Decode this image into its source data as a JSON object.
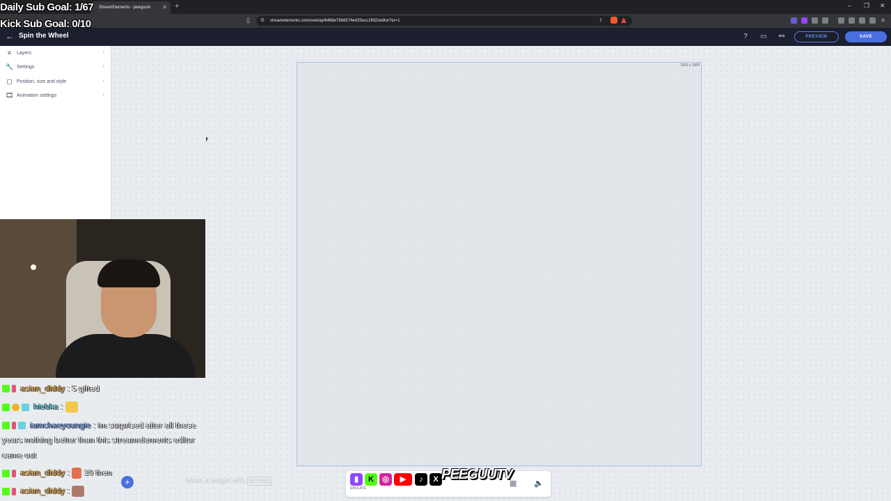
{
  "browser": {
    "tab_title": "StreamElements - peeguutv",
    "url": "streamelements.com/overlay/6468e789d574e425ecc1ffd2/editor?er=1"
  },
  "app": {
    "title": "Spin the Wheel",
    "preview_label": "PREVIEW",
    "save_label": "SAVE"
  },
  "sidebar": {
    "items": [
      {
        "label": "Layers",
        "icon": "menu-icon"
      },
      {
        "label": "Settings",
        "icon": "wrench-icon"
      },
      {
        "label": "Position, size and style",
        "icon": "square-icon"
      },
      {
        "label": "Animation settings",
        "icon": "film-icon"
      }
    ]
  },
  "canvas": {
    "dimensions": "1001 x 1000"
  },
  "overlay": {
    "daily_goal": "Daily Sub Goal: 1/67",
    "kick_goal": "Kick Sub Goal: 0/10"
  },
  "chat": [
    {
      "user": "asian_diddy",
      "separator": ":",
      "message": "5 gifted"
    },
    {
      "user": "hiebka",
      "separator": ":",
      "message": ""
    },
    {
      "user": "iamchaeyoungie",
      "separator": ":",
      "message": "im surprised after all these"
    },
    {
      "continuation": "years nothing better than this streamelements editor"
    },
    {
      "continuation": "came out"
    },
    {
      "user": "asian_diddy",
      "separator": ":",
      "message": "10 then"
    },
    {
      "user": "asian_diddy",
      "separator": ":",
      "message": ""
    }
  ],
  "hint": {
    "text": "Move a widget with",
    "key": "arrows"
  },
  "bottom_bar": {
    "emulate_label": "EMULATE",
    "brand_text": "PEEGUUTV"
  },
  "colors": {
    "accent": "#4a6ee0",
    "header_bg": "#1b1f2e"
  }
}
